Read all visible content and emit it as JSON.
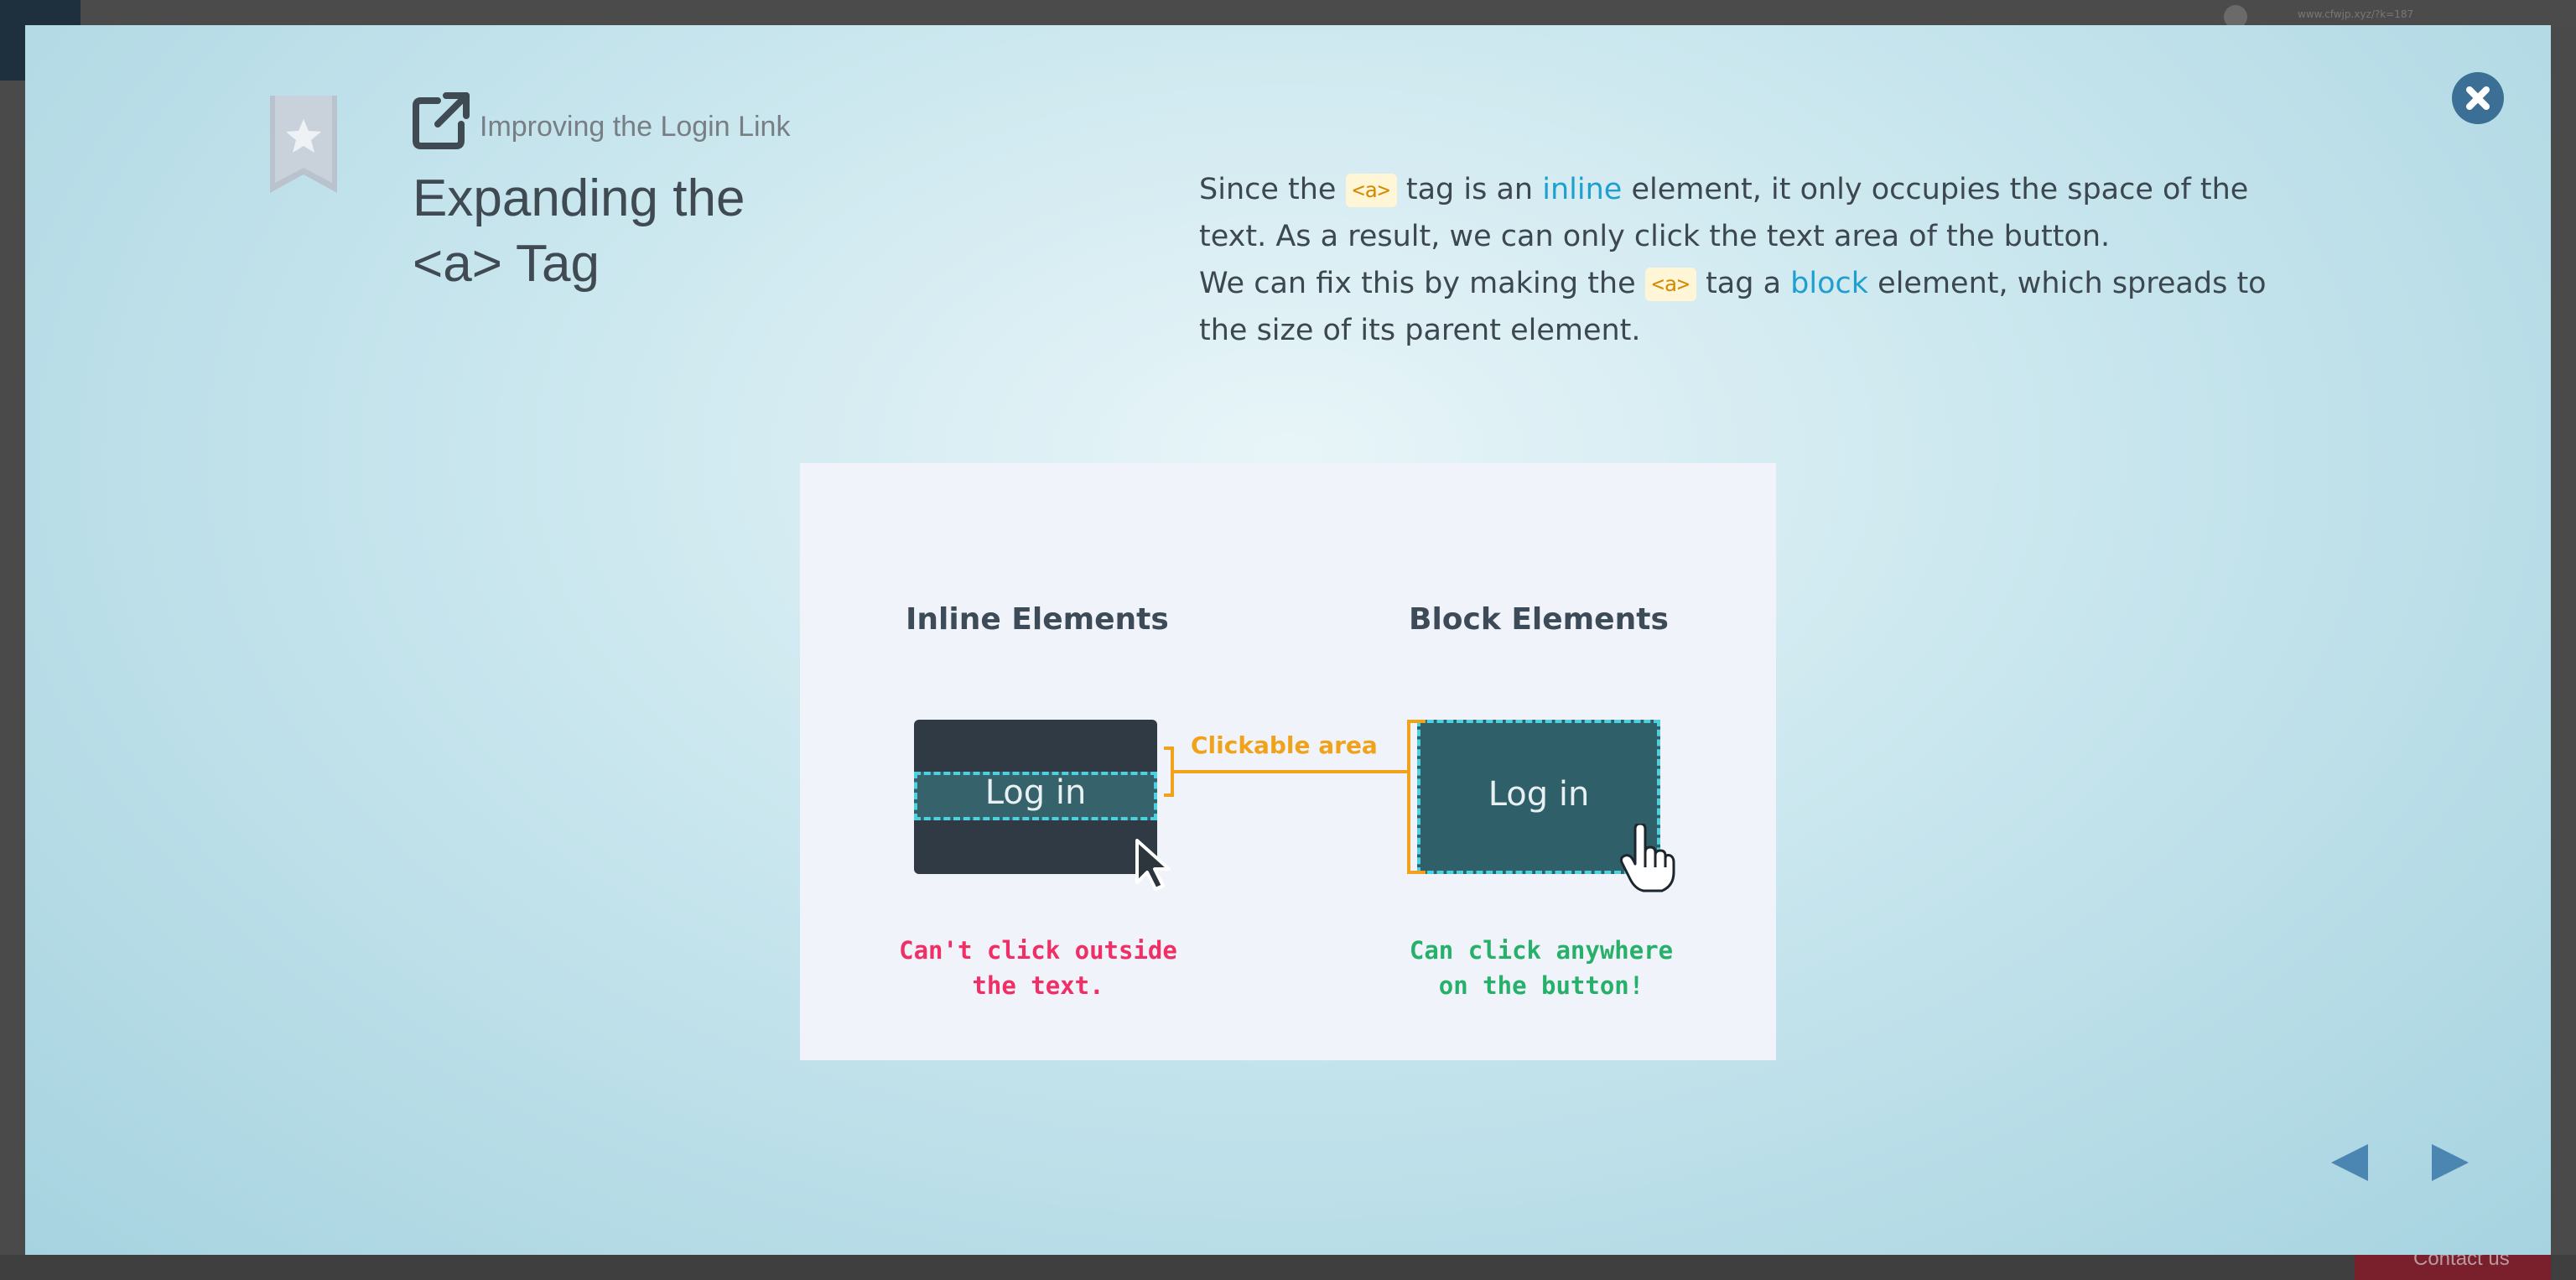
{
  "background": {
    "url_text": "www.cfwjp.xyz/?k=187",
    "contact_label": "Contact us"
  },
  "modal": {
    "breadcrumb": "Improving the Login Link",
    "title_line1": "Expanding the",
    "title_line2": "<a> Tag",
    "description": {
      "p1_before": "Since the ",
      "p1_code": "<a>",
      "p1_mid": " tag is an ",
      "p1_keyword": "inline",
      "p1_after": " element, it only occupies the space of the text. As a result, we can only click the text area of the button.",
      "p2_before": "We can fix this by making the ",
      "p2_code": "<a>",
      "p2_mid": " tag a ",
      "p2_keyword": "block",
      "p2_after": " element, which spreads to the size of its parent element."
    },
    "illustration": {
      "inline_heading": "Inline Elements",
      "block_heading": "Block Elements",
      "inline_button_label": "Log in",
      "block_button_label": "Log in",
      "clickable_label": "Clickable area",
      "inline_caption_line1": "Can't click outside",
      "inline_caption_line2": "the text.",
      "block_caption_line1": "Can click anywhere",
      "block_caption_line2": "on the button!"
    },
    "icons": {
      "bookmark": "bookmark-star-icon",
      "external": "external-link-icon",
      "close": "close-icon",
      "prev": "prev-arrow-icon",
      "next": "next-arrow-icon"
    },
    "colors": {
      "accent": "#3b6f96",
      "keyword": "#1f9fcf",
      "code_text": "#d48a00",
      "clickable": "#f0a21a",
      "negative": "#ef2f66",
      "positive": "#26b06a"
    }
  }
}
